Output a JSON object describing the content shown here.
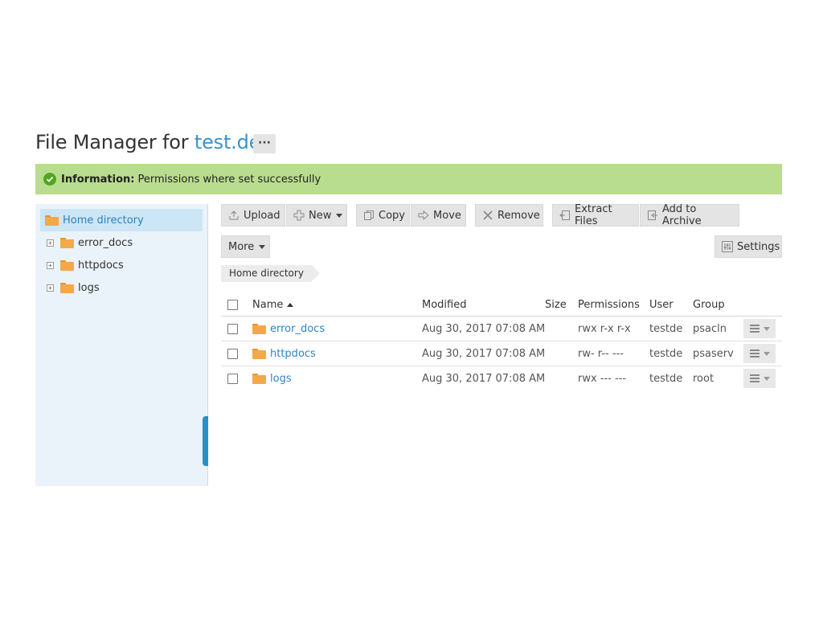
{
  "header": {
    "title_prefix": "File Manager for",
    "domain": "test.de",
    "more_label": "···"
  },
  "info": {
    "label": "Information:",
    "message": "Permissions where set successfully"
  },
  "sidebar": {
    "root": "Home directory",
    "items": [
      {
        "label": "error_docs",
        "expander": "+"
      },
      {
        "label": "httpdocs",
        "expander": "+"
      },
      {
        "label": "logs",
        "expander": "+"
      }
    ]
  },
  "toolbar": {
    "upload": "Upload",
    "new": "New",
    "copy": "Copy",
    "move": "Move",
    "remove": "Remove",
    "extract": "Extract Files",
    "archive": "Add to Archive",
    "more": "More",
    "settings": "Settings"
  },
  "breadcrumb": "Home directory",
  "table": {
    "columns": {
      "name": "Name",
      "modified": "Modified",
      "size": "Size",
      "permissions": "Permissions",
      "user": "User",
      "group": "Group"
    },
    "rows": [
      {
        "name": "error_docs",
        "modified": "Aug 30, 2017 07:08 AM",
        "size": "",
        "permissions": "rwx r-x r-x",
        "user": "testde",
        "group": "psacln"
      },
      {
        "name": "httpdocs",
        "modified": "Aug 30, 2017 07:08 AM",
        "size": "",
        "permissions": "rw- r-- ---",
        "user": "testde",
        "group": "psaserv"
      },
      {
        "name": "logs",
        "modified": "Aug 30, 2017 07:08 AM",
        "size": "",
        "permissions": "rwx --- ---",
        "user": "testde",
        "group": "root"
      }
    ]
  },
  "icons": {
    "upload": "upload-icon",
    "new": "plus-icon",
    "copy": "copy-icon",
    "move": "move-arrow-icon",
    "remove": "x-icon",
    "extract": "extract-icon",
    "archive": "archive-icon",
    "settings": "sliders-icon",
    "folder": "folder-icon"
  },
  "colors": {
    "accent": "#3a93c9",
    "info_bg": "#b9dd8e",
    "success": "#52a520",
    "folder": "#f3a84a"
  }
}
